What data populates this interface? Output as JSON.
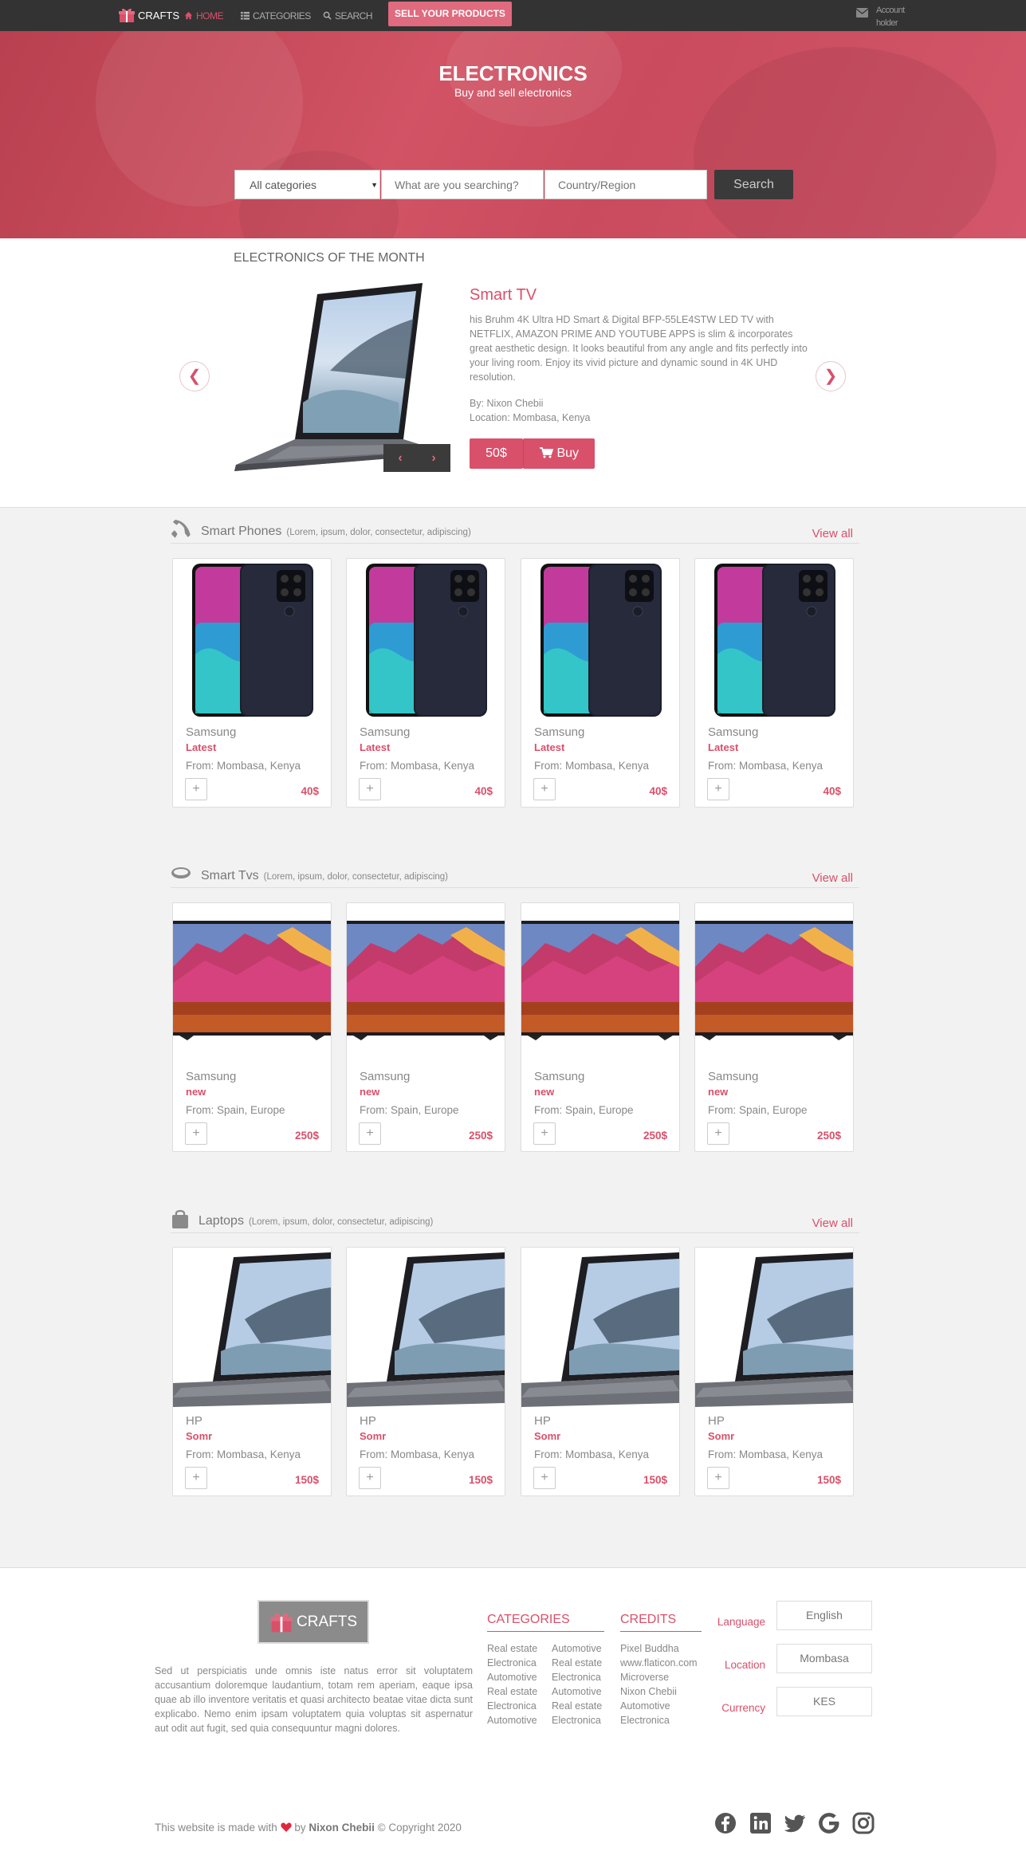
{
  "nav": {
    "brand": "CRAFTS",
    "home": "HOME",
    "categories": "CATEGORIES",
    "search": "SEARCH",
    "sell": "SELL YOUR PRODUCTS",
    "account_line1": "Account",
    "account_line2": "holder"
  },
  "hero": {
    "title": "ELECTRONICS",
    "subtitle": "Buy and sell electronics",
    "category_select": "All categories",
    "search_placeholder": "What are you searching?",
    "region_placeholder": "Country/Region",
    "search_button": "Search"
  },
  "featured": {
    "heading": "ELECTRONICS OF THE MONTH",
    "title": "Smart TV",
    "description": "his Bruhm 4K Ultra HD Smart & Digital BFP-55LE4STW LED TV with NETFLIX, AMAZON PRIME AND YOUTUBE APPS is slim & incorporates great aesthetic design. It looks beautiful from any angle and fits perfectly into your living room. Enjoy its vivid picture and dynamic sound in 4K UHD resolution.",
    "by": "By: Nixon Chebii",
    "location": "Location: Mombasa, Kenya",
    "price": "50$",
    "buy": "Buy"
  },
  "sections": [
    {
      "title": "Smart Phones",
      "subtitle": "(Lorem, ipsum, dolor, consectetur, adipiscing)",
      "view_all": "View all",
      "items": [
        {
          "brand": "Samsung",
          "tag": "Latest",
          "from": "From: Mombasa, Kenya",
          "price": "40$"
        },
        {
          "brand": "Samsung",
          "tag": "Latest",
          "from": "From: Mombasa, Kenya",
          "price": "40$"
        },
        {
          "brand": "Samsung",
          "tag": "Latest",
          "from": "From: Mombasa, Kenya",
          "price": "40$"
        },
        {
          "brand": "Samsung",
          "tag": "Latest",
          "from": "From: Mombasa, Kenya",
          "price": "40$"
        }
      ]
    },
    {
      "title": "Smart Tvs",
      "subtitle": "(Lorem, ipsum, dolor, consectetur, adipiscing)",
      "view_all": "View all",
      "items": [
        {
          "brand": "Samsung",
          "tag": "new",
          "from": "From: Spain, Europe",
          "price": "250$"
        },
        {
          "brand": "Samsung",
          "tag": "new",
          "from": "From: Spain, Europe",
          "price": "250$"
        },
        {
          "brand": "Samsung",
          "tag": "new",
          "from": "From: Spain, Europe",
          "price": "250$"
        },
        {
          "brand": "Samsung",
          "tag": "new",
          "from": "From: Spain, Europe",
          "price": "250$"
        }
      ]
    },
    {
      "title": "Laptops",
      "subtitle": "(Lorem, ipsum, dolor, consectetur, adipiscing)",
      "view_all": "View all",
      "items": [
        {
          "brand": "HP",
          "tag": "Somr",
          "from": "From: Mombasa, Kenya",
          "price": "150$"
        },
        {
          "brand": "HP",
          "tag": "Somr",
          "from": "From: Mombasa, Kenya",
          "price": "150$"
        },
        {
          "brand": "HP",
          "tag": "Somr",
          "from": "From: Mombasa, Kenya",
          "price": "150$"
        },
        {
          "brand": "HP",
          "tag": "Somr",
          "from": "From: Mombasa, Kenya",
          "price": "150$"
        }
      ]
    }
  ],
  "footer": {
    "brand": "CRAFTS",
    "about": "Sed ut perspiciatis unde omnis iste natus error sit voluptatem accusantium doloremque laudantium, totam rem aperiam, eaque ipsa quae ab illo inventore veritatis et quasi architecto beatae vitae dicta sunt explicabo. Nemo enim ipsam voluptatem quia voluptas sit aspernatur aut odit aut fugit, sed quia consequuntur magni dolores.",
    "categories_title": "CATEGORIES",
    "categories_col1": [
      "Real estate",
      "Electronica",
      "Automotive",
      "Real estate",
      "Electronica",
      "Automotive"
    ],
    "categories_col2": [
      "Automotive",
      "Real estate",
      "Electronica",
      "Automotive",
      "Real estate",
      "Electronica"
    ],
    "credits_title": "CREDITS",
    "credits": [
      "Pixel Buddha",
      "www.flaticon.com",
      "Microverse",
      "Nixon Chebii",
      "Automotive",
      "Electronica"
    ],
    "language_label": "Language",
    "language_value": "English",
    "location_label": "Location",
    "location_value": "Mombasa",
    "currency_label": "Currency",
    "currency_value": "KES",
    "copy_prefix": "This website is made with",
    "copy_by": "by",
    "copy_name": "Nixon Chebii",
    "copy_suffix": "© Copyright 2020"
  },
  "colors": {
    "accent": "#d9506a",
    "nav_bg": "#333333",
    "hero_bg": "#c94b5d"
  },
  "icons": [
    "gift-icon",
    "home-icon",
    "list-icon",
    "search-icon",
    "envelope-icon",
    "phone-icon",
    "tv-icon",
    "bag-icon",
    "cart-icon",
    "heart-icon",
    "facebook-icon",
    "linkedin-icon",
    "twitter-icon",
    "google-icon",
    "instagram-icon"
  ]
}
